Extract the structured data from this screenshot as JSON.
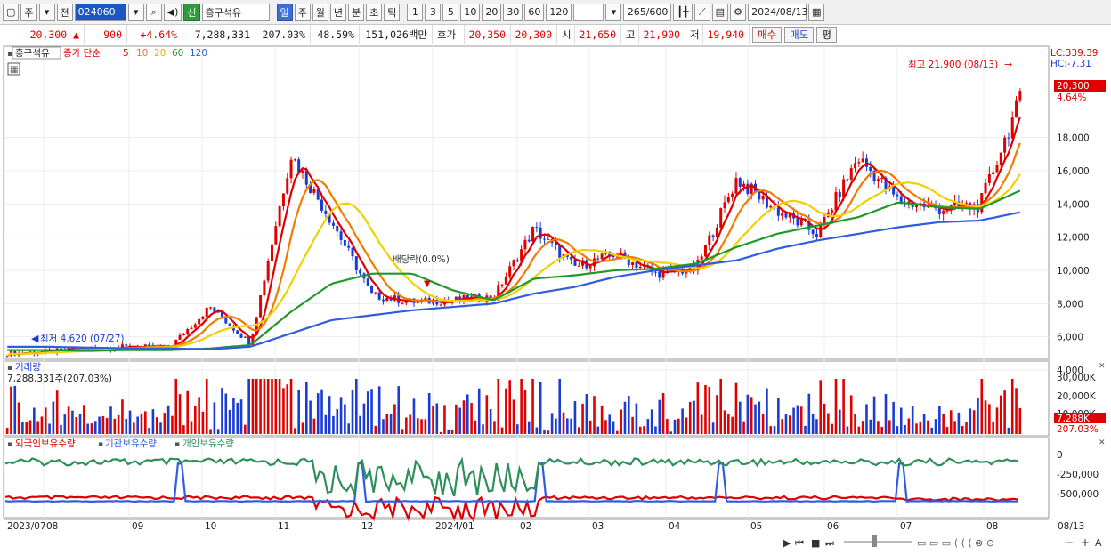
{
  "toolbar": {
    "market_label": "주",
    "prev_label": "전",
    "code": "024060",
    "stock_badge": "신",
    "stock_name": "흥구석유",
    "periods": [
      "일",
      "주",
      "월",
      "년",
      "분",
      "초",
      "틱"
    ],
    "active_period": "일",
    "intervals": [
      "1",
      "3",
      "5",
      "10",
      "20",
      "30",
      "60",
      "120"
    ],
    "count": "265",
    "count_max": "/600",
    "date": "2024/08/13"
  },
  "quote": {
    "price": "20,300",
    "change_symbol": "▲",
    "change": "900",
    "change_pct": "+4.64%",
    "volume": "7,288,331",
    "volume_ratio": "207.03%",
    "turnover_pct": "48.59%",
    "amount": "151,026백만",
    "bid_label": "호가",
    "bid1": "20,350",
    "bid2": "20,300",
    "open_label": "시",
    "open": "21,650",
    "high_label": "고",
    "high": "21,900",
    "low_label": "저",
    "low": "19,940",
    "buy_btn": "매수",
    "sell_btn": "매도",
    "eval_btn": "평"
  },
  "price_panel": {
    "stock_tag": "흥구석유",
    "ma_label": "종가 단순",
    "ma_periods": [
      "5",
      "10",
      "20",
      "60",
      "120"
    ],
    "ma_colors": [
      "#e00000",
      "#f07b00",
      "#f0d000",
      "#1f9a2a",
      "#2f5ce0"
    ],
    "lc": "LC:339.39",
    "hc": "HC:-7.31",
    "high_annotation": "최고 21,900 (08/13)",
    "low_annotation": "최저 4,620 (07/27)",
    "dividend_annotation": "배당락(0.0%)",
    "price_tag": "20,300",
    "pct_tag": "4.64%",
    "y_ticks": [
      "18,000",
      "16,000",
      "14,000",
      "12,000",
      "10,000",
      "8,000",
      "6,000",
      "4,000"
    ]
  },
  "volume_panel": {
    "title": "거래량",
    "value": "7,288,331주(207.03%)",
    "y_ticks": [
      "30,000K",
      "20,000K",
      "10,000K"
    ],
    "tag": "7,288K",
    "tag_pct": "207.03%"
  },
  "holding_panel": {
    "series": [
      "외국인보유수량",
      "기관보유수량",
      "개인보유수량"
    ],
    "series_colors": [
      "#e00000",
      "#2f5ce0",
      "#2f8f5a"
    ],
    "y_ticks": [
      "0",
      "-250,000",
      "-500,000"
    ]
  },
  "x_axis": {
    "labels": [
      "2023/07",
      "08",
      "09",
      "10",
      "11",
      "12",
      "2024/01",
      "02",
      "03",
      "04",
      "05",
      "06",
      "07",
      "08"
    ],
    "end_label": "08/13"
  },
  "chart_data": {
    "type": "line",
    "title": "",
    "series": [
      {
        "name": "종가",
        "values": [
          5000,
          5100,
          5300,
          5400,
          5350,
          7800,
          5600,
          17000,
          13000,
          8500,
          8100,
          8200,
          8400,
          12500,
          10200,
          11000,
          9800,
          10100,
          15500,
          13600,
          12200,
          16800,
          14200,
          13700,
          13900,
          20300
        ]
      },
      {
        "name": "60",
        "values": [
          5200,
          5200,
          5150,
          5200,
          5200,
          5300,
          5500,
          7500,
          9200,
          9800,
          9800,
          8800,
          8200,
          9500,
          9700,
          10000,
          10100,
          10400,
          11400,
          12200,
          12700,
          13200,
          14100,
          13800,
          13700,
          14800
        ]
      },
      {
        "name": "120",
        "values": [
          5400,
          5400,
          5350,
          5300,
          5300,
          5250,
          5400,
          6200,
          7000,
          7300,
          7600,
          7800,
          8000,
          8600,
          9000,
          9600,
          10000,
          10300,
          10600,
          11300,
          11800,
          12200,
          12600,
          12900,
          13000,
          13500
        ]
      }
    ],
    "ylim": [
      4000,
      22000
    ]
  }
}
